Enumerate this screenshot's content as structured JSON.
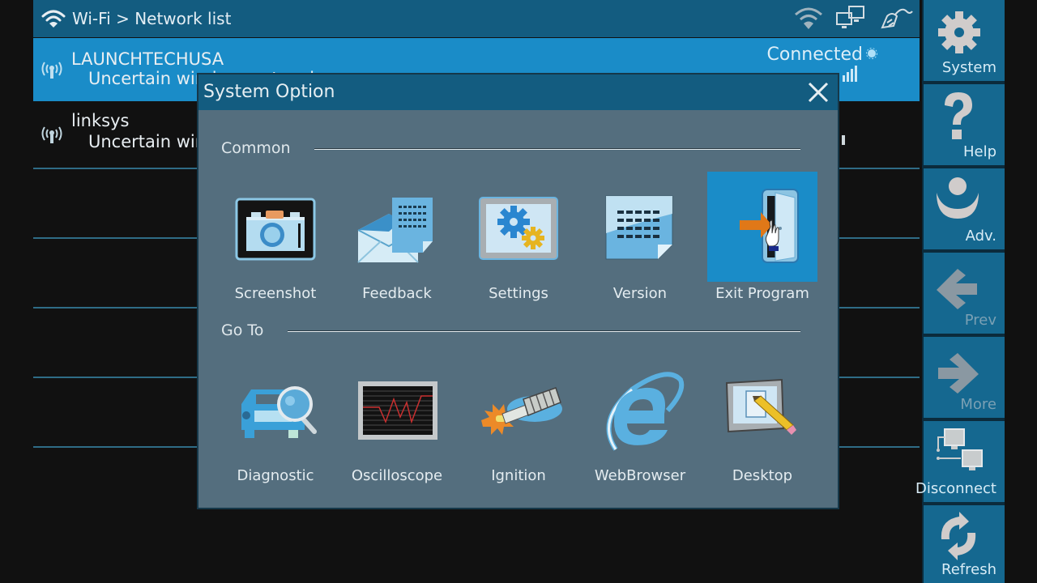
{
  "topbar": {
    "title": "Wi-Fi > Network list",
    "icons": [
      "wifi-icon",
      "network-computers-icon",
      "power-plug-icon"
    ]
  },
  "networks": [
    {
      "ssid": "LAUNCHTECHUSA",
      "security": "Uncertain wireless network",
      "status": "Connected",
      "selected": true
    },
    {
      "ssid": "linksys",
      "security": "Uncertain wireless network",
      "status": "",
      "selected": false
    }
  ],
  "sidebar": {
    "buttons": [
      {
        "label": "System",
        "icon": "gear-icon",
        "enabled": true
      },
      {
        "label": "Help",
        "icon": "question-icon",
        "enabled": true
      },
      {
        "label": "Adv.",
        "icon": "advanced-icon",
        "enabled": true
      },
      {
        "label": "Prev",
        "icon": "arrow-left-icon",
        "enabled": false
      },
      {
        "label": "More",
        "icon": "arrow-right-icon",
        "enabled": false
      },
      {
        "label": "Disconnect",
        "icon": "disconnect-icon",
        "enabled": true
      },
      {
        "label": "Refresh",
        "icon": "refresh-icon",
        "enabled": true
      }
    ]
  },
  "dialog": {
    "title": "System Option",
    "close_icon": "close-icon",
    "sections": [
      {
        "label": "Common",
        "items": [
          {
            "label": "Screenshot",
            "icon": "camera-icon",
            "selected": false
          },
          {
            "label": "Feedback",
            "icon": "feedback-mail-icon",
            "selected": false
          },
          {
            "label": "Settings",
            "icon": "settings-gears-icon",
            "selected": false
          },
          {
            "label": "Version",
            "icon": "version-document-icon",
            "selected": false
          },
          {
            "label": "Exit Program",
            "icon": "exit-door-icon",
            "selected": true
          }
        ]
      },
      {
        "label": "Go To",
        "items": [
          {
            "label": "Diagnostic",
            "icon": "car-magnifier-icon",
            "selected": false
          },
          {
            "label": "Oscilloscope",
            "icon": "oscilloscope-icon",
            "selected": false
          },
          {
            "label": "Ignition",
            "icon": "spark-plug-icon",
            "selected": false
          },
          {
            "label": "WebBrowser",
            "icon": "web-browser-icon",
            "selected": false
          },
          {
            "label": "Desktop",
            "icon": "desktop-pencil-icon",
            "selected": false
          }
        ]
      }
    ]
  },
  "colors": {
    "topbar": "#135c80",
    "selected_row": "#1a8cc8",
    "sidebar_button": "#156890",
    "dialog_body": "#546e7e",
    "background": "#111111"
  }
}
